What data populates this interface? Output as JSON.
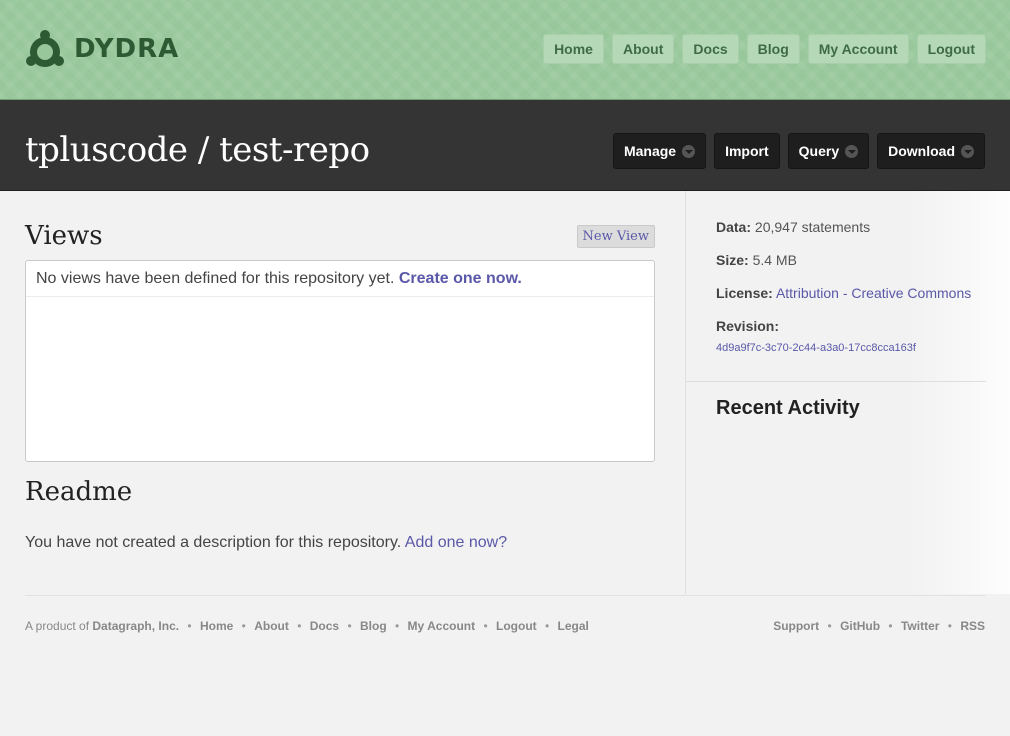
{
  "brand": {
    "name": "DYDRA",
    "logo_icon": "dydra-logo-icon"
  },
  "topnav": [
    "Home",
    "About",
    "Docs",
    "Blog",
    "My Account",
    "Logout"
  ],
  "repo": {
    "title": "tpluscode / test-repo",
    "actions": [
      {
        "label": "Manage",
        "dropdown": true
      },
      {
        "label": "Import",
        "dropdown": false
      },
      {
        "label": "Query",
        "dropdown": true
      },
      {
        "label": "Download",
        "dropdown": true
      }
    ]
  },
  "views": {
    "heading": "Views",
    "new_view_label": "New View",
    "empty_message": "No views have been defined for this repository yet.",
    "create_link": "Create one now."
  },
  "readme": {
    "heading": "Readme",
    "empty_message": "You have not created a description for this repository.",
    "add_link": "Add one now?"
  },
  "sidebar": {
    "data_label": "Data:",
    "data_value": "20,947 statements",
    "size_label": "Size:",
    "size_value": "5.4 MB",
    "license_label": "License:",
    "license_value": "Attribution - Creative Commons",
    "revision_label": "Revision:",
    "revision_value": "4d9a9f7c-3c70-2c44-a3a0-17cc8cca163f",
    "activity_heading": "Recent Activity"
  },
  "footer": {
    "prefix": "A product of",
    "company": "Datagraph, Inc.",
    "left_links": [
      "Home",
      "About",
      "Docs",
      "Blog",
      "My Account",
      "Logout",
      "Legal"
    ],
    "right_links": [
      "Support",
      "GitHub",
      "Twitter",
      "RSS"
    ]
  },
  "colors": {
    "header_green": "#97c79a",
    "repo_bar": "#343434",
    "link": "#5a58a8"
  }
}
